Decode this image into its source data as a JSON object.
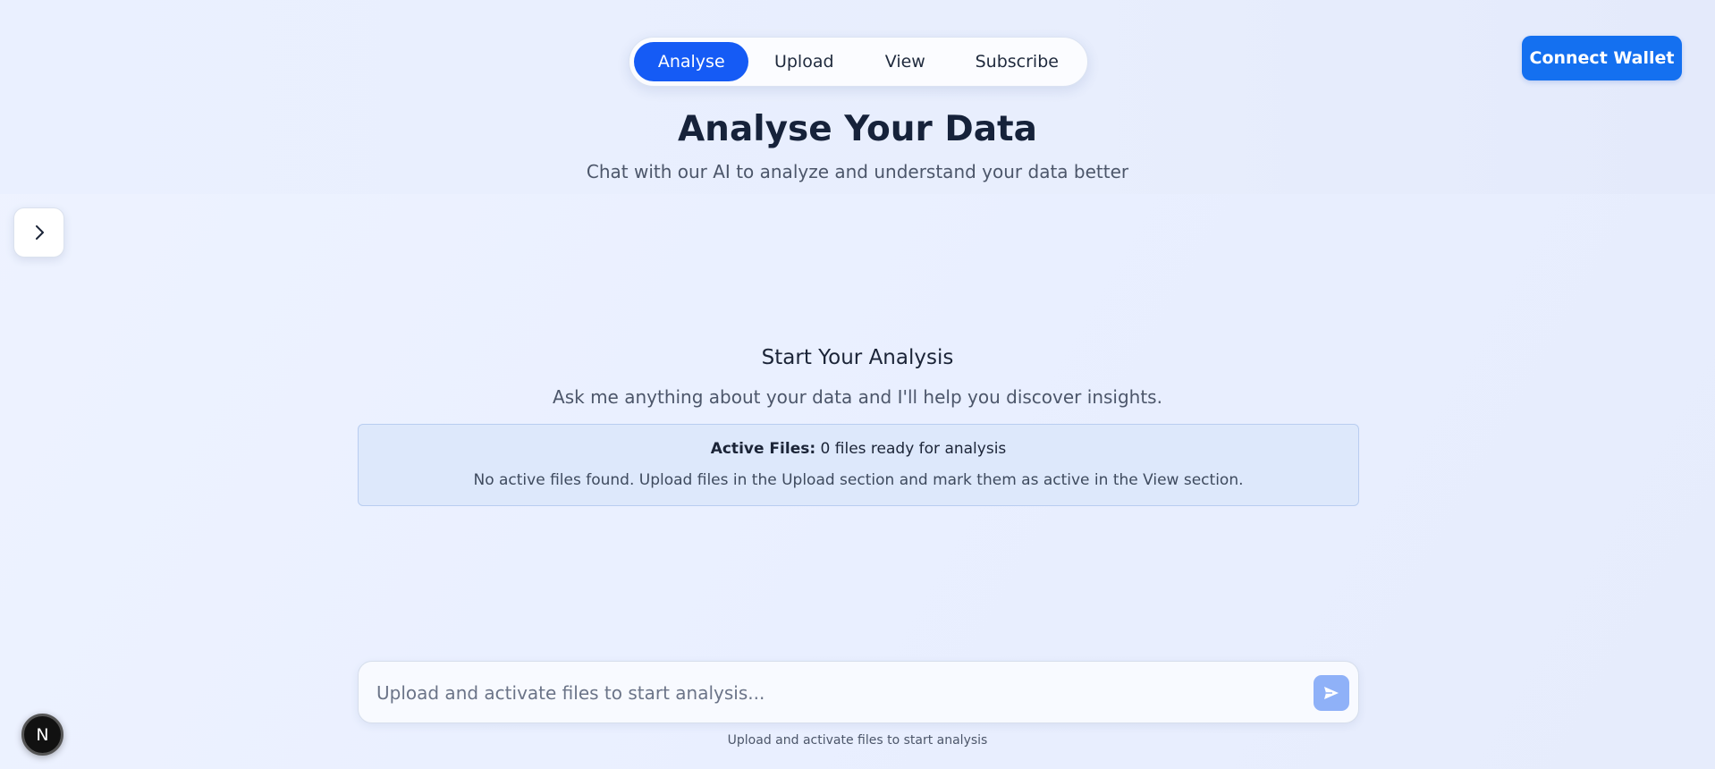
{
  "nav": {
    "tabs": [
      {
        "label": "Analyse",
        "active": true
      },
      {
        "label": "Upload",
        "active": false
      },
      {
        "label": "View",
        "active": false
      },
      {
        "label": "Subscribe",
        "active": false
      }
    ]
  },
  "header": {
    "connect_label": "Connect Wallet",
    "title": "Analyse Your Data",
    "subtitle": "Chat with our AI to analyze and understand your data better"
  },
  "empty_state": {
    "title": "Start Your Analysis",
    "description": "Ask me anything about your data and I'll help you discover insights."
  },
  "active_files": {
    "label": "Active Files:",
    "count_text": "0 files ready for analysis",
    "message": "No active files found. Upload files in the Upload section and mark them as active in the View section."
  },
  "chat": {
    "placeholder": "Upload and activate files to start analysis...",
    "hint": "Upload and activate files to start analysis"
  },
  "badge": {
    "letter": "N"
  },
  "icons": {
    "sidebar_toggle": "chevron-right-icon",
    "send": "send-icon"
  },
  "colors": {
    "accent": "#155bf5",
    "connect": "#1470f0",
    "send_disabled": "#8fb1f8"
  }
}
